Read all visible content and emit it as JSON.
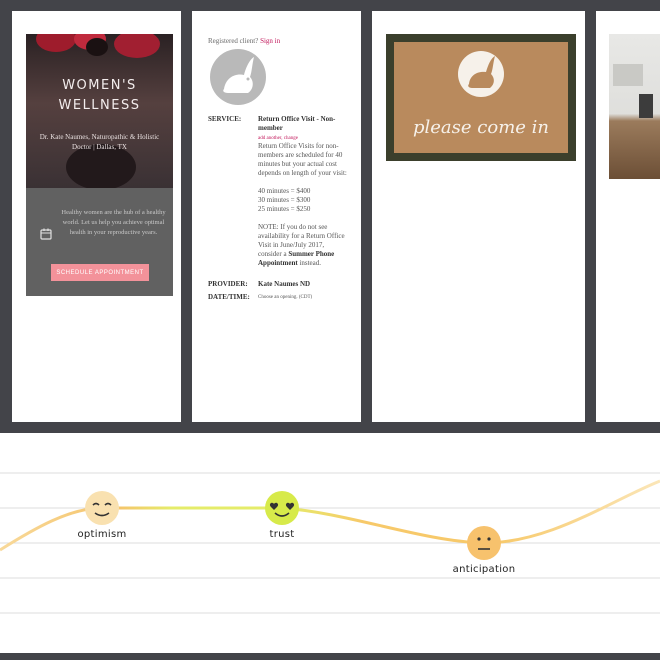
{
  "colors": {
    "background": "#434449",
    "accent_pink": "#c2185b",
    "button_pink": "#f3929a",
    "curve": "#f7c96a",
    "curve_green": "#e5ec6a"
  },
  "frame1": {
    "title": "WOMEN'S\nWELLNESS",
    "subtitle": "Dr. Kate Naumes, Naturopathic & Holistic Doctor | Dallas, TX",
    "blurb": "Healthy women are the hub of a healthy world. Let us help you achieve optimal health in your reproductive years.",
    "schedule_button": "SCHEDULE APPOINTMENT",
    "calendar_icon": "calendar-icon"
  },
  "frame2": {
    "registered_prefix": "Registered client?",
    "sign_in": "Sign in",
    "logo_icon": "rabbit-logo-icon",
    "service_key": "SERVICE:",
    "service_name": "Return Office Visit - Non-member",
    "service_actions": "add another, change",
    "service_desc": "Return Office Visits for non-members are scheduled for 40 minutes but your actual cost depends on length of your visit:",
    "prices": [
      "40 minutes = $400",
      "30 minutes = $300",
      "25 minutes = $250"
    ],
    "note_prefix": "NOTE: If you do not see availability for a Return Office Visit in June/July 2017, consider a",
    "note_link": "Summer Phone Appointment",
    "note_suffix": "instead.",
    "provider_key": "PROVIDER:",
    "provider_val": "Kate Naumes ND",
    "datetime_key": "DATE/TIME:",
    "datetime_val": "Choose an opening. (CDT)"
  },
  "frame3": {
    "mat_text": "please come in",
    "logo_icon": "rabbit-logo-icon"
  },
  "journey": {
    "points": [
      {
        "label": "optimism",
        "icon": "smiling-face-icon",
        "face": "content"
      },
      {
        "label": "trust",
        "icon": "heart-eyes-face-icon",
        "face": "love"
      },
      {
        "label": "anticipation",
        "icon": "neutral-face-icon",
        "face": "neutral"
      }
    ]
  }
}
